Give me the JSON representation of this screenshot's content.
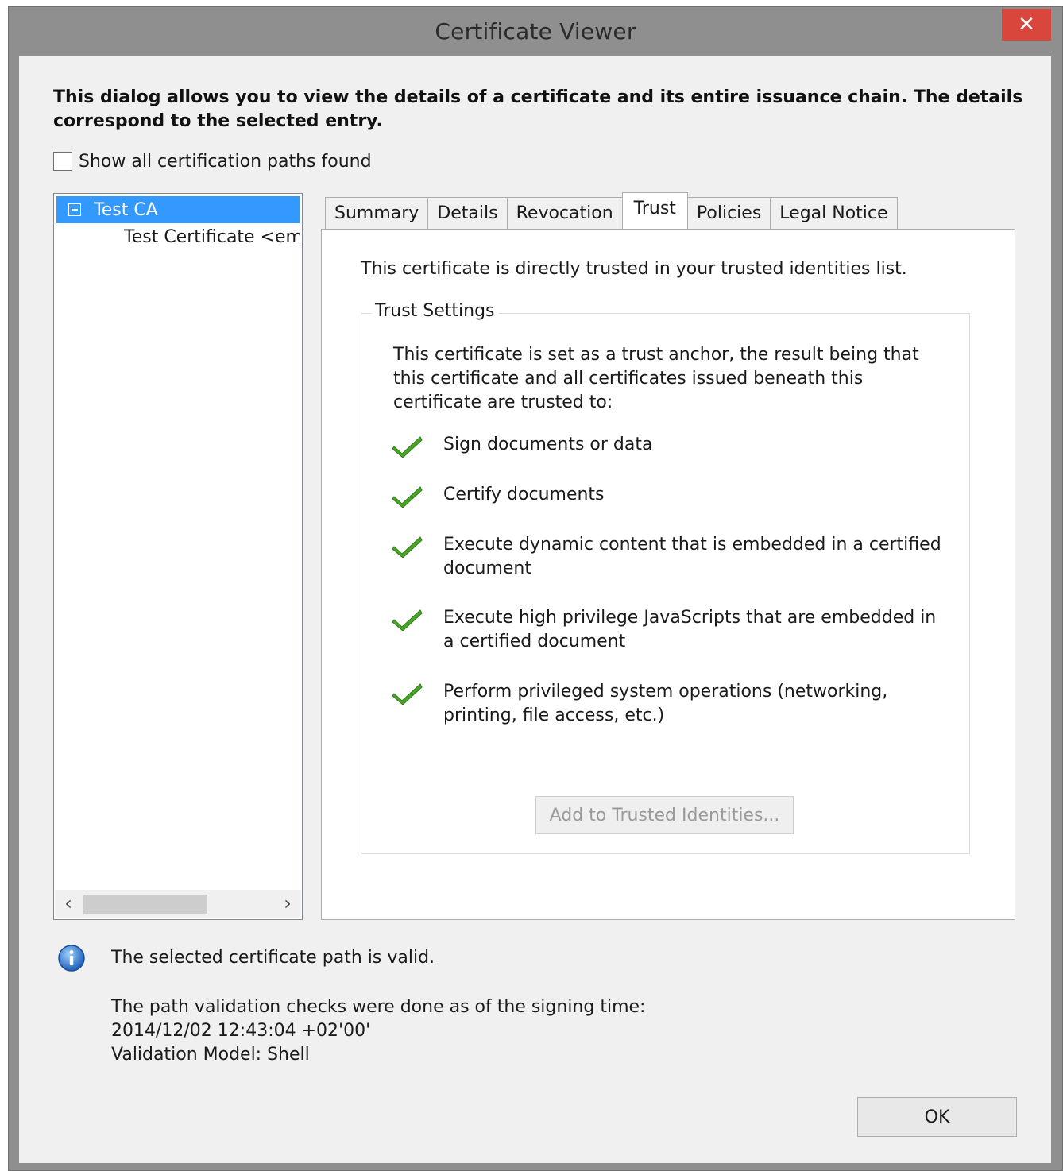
{
  "window": {
    "title": "Certificate Viewer",
    "close_glyph": "✕"
  },
  "intro": "This dialog allows you to view the details of a certificate and its entire issuance chain. The details correspond to the selected entry.",
  "show_all_paths": {
    "label": "Show all certification paths found",
    "checked": false
  },
  "tree": {
    "selected": "Test CA",
    "child": "Test Certificate <ema",
    "scroll_left": "‹",
    "scroll_right": "›"
  },
  "tabs": [
    {
      "label": "Summary",
      "active": false
    },
    {
      "label": "Details",
      "active": false
    },
    {
      "label": "Revocation",
      "active": false
    },
    {
      "label": "Trust",
      "active": true
    },
    {
      "label": "Policies",
      "active": false
    },
    {
      "label": "Legal Notice",
      "active": false
    }
  ],
  "trust": {
    "message": "This certificate is directly trusted in your trusted identities list.",
    "group_title": "Trust Settings",
    "group_description": "This certificate is set as a trust anchor, the result being that this certificate and all certificates issued beneath this certificate are trusted to:",
    "items": [
      {
        "label": "Sign documents or data",
        "icon": "green-check-icon"
      },
      {
        "label": "Certify documents",
        "icon": "green-check-icon"
      },
      {
        "label": "Execute dynamic content that is embedded in a certified document",
        "icon": "green-check-icon"
      },
      {
        "label": "Execute high privilege JavaScripts that are embedded in a certified document",
        "icon": "green-check-icon"
      },
      {
        "label": "Perform privileged system operations (networking, printing, file access, etc.)",
        "icon": "green-check-icon"
      }
    ],
    "add_button": "Add to Trusted Identities..."
  },
  "status": {
    "valid": "The selected certificate path is valid.",
    "line1": "The path validation checks were done as of the signing time:",
    "line2": "2014/12/02 12:43:04 +02'00'",
    "line3": "Validation Model: Shell"
  },
  "ok_button": "OK",
  "colors": {
    "selection": "#3399ff",
    "close": "#d9463b",
    "check": "#4aa629"
  }
}
